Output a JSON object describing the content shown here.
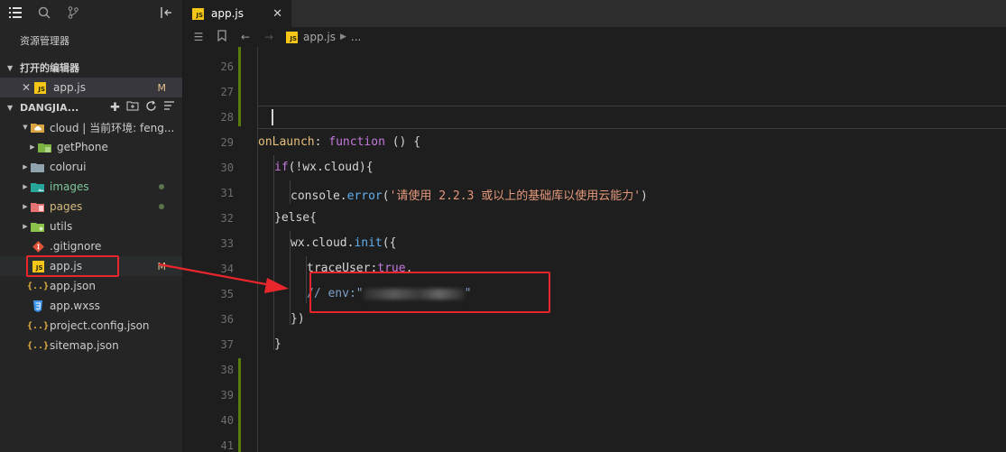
{
  "sidebar": {
    "title": "资源管理器",
    "open_editors": {
      "header": "打开的编辑器",
      "items": [
        {
          "label": "app.js",
          "badge": "M"
        }
      ]
    },
    "project": {
      "name": "DANGJIA...",
      "tree": [
        {
          "label": "cloud | 当前环境: feng...",
          "icon": "cloud-folder-icon",
          "expanded": true
        },
        {
          "label": "getPhone",
          "icon": "folder-icon"
        },
        {
          "label": "colorui",
          "icon": "folder-icon"
        },
        {
          "label": "images",
          "icon": "images-folder-icon"
        },
        {
          "label": "pages",
          "icon": "pages-folder-icon"
        },
        {
          "label": "utils",
          "icon": "utils-folder-icon"
        },
        {
          "label": ".gitignore",
          "icon": "git-icon"
        },
        {
          "label": "app.js",
          "icon": "js-file-icon",
          "badge": "M"
        },
        {
          "label": "app.json",
          "icon": "json-file-icon"
        },
        {
          "label": "app.wxss",
          "icon": "css-file-icon"
        },
        {
          "label": "project.config.json",
          "icon": "json-file-icon"
        },
        {
          "label": "sitemap.json",
          "icon": "json-file-icon"
        }
      ]
    }
  },
  "tabs": [
    {
      "label": "app.js",
      "active": true
    }
  ],
  "breadcrumb": {
    "file": "app.js",
    "rest": "..."
  },
  "editor": {
    "line_numbers": [
      "26",
      "27",
      "28",
      "29",
      "30",
      "31",
      "32",
      "33",
      "34",
      "35",
      "36",
      "37",
      "38",
      "39",
      "40",
      "41"
    ],
    "code": {
      "l29a": "onLaunch",
      "l29b": ": ",
      "l29c": "function",
      "l29d": " () {",
      "l30a": "if",
      "l30b": "(!wx.cloud){",
      "l31a": "console.",
      "l31b": "error",
      "l31c": "(",
      "l31d": "'请使用 2.2.3 或以上的基础库以使用云能力'",
      "l31e": ")",
      "l32": "}else{",
      "l33a": "wx.cloud.",
      "l33b": "init",
      "l33c": "({",
      "l34a": "traceUser",
      "l34b": ":",
      "l34c": "true",
      "l34d": ",",
      "l35a": "// env:\"",
      "l35b": "\"",
      "l36": "})",
      "l37": "}"
    }
  },
  "colors": {
    "annotation": "#e8262c",
    "git_added": "#587c0c",
    "modified_badge": "#e2c08d"
  }
}
